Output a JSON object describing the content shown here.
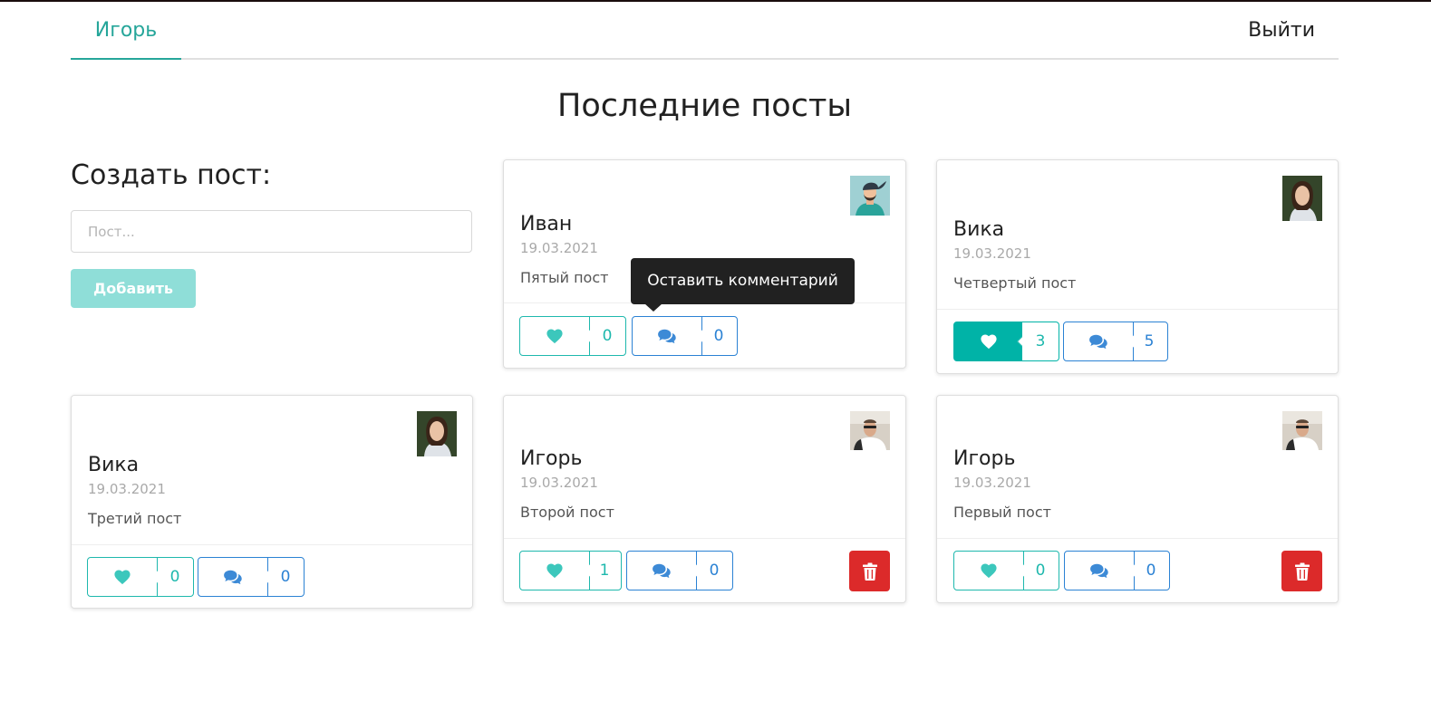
{
  "nav": {
    "user_name": "Игорь",
    "logout_label": "Выйти"
  },
  "page_title": "Последние посты",
  "create": {
    "title": "Создать пост:",
    "placeholder": "Пост...",
    "add_label": "Добавить"
  },
  "tooltip": "Оставить комментарий",
  "colors": {
    "accent": "#26a69a",
    "like": "#1eb8ad",
    "comment": "#2b82d4",
    "delete": "#dc2a2a",
    "add_button": "#8fded8"
  },
  "posts": [
    {
      "author": "Иван",
      "date": "19.03.2021",
      "text": "Пятый пост",
      "likes": "0",
      "comments": "0",
      "liked": false
    },
    {
      "author": "Вика",
      "date": "19.03.2021",
      "text": "Четвертый пост",
      "likes": "3",
      "comments": "5",
      "liked": true
    },
    {
      "author": "Вика",
      "date": "19.03.2021",
      "text": "Третий пост",
      "likes": "0",
      "comments": "0",
      "liked": false
    },
    {
      "author": "Игорь",
      "date": "19.03.2021",
      "text": "Второй пост",
      "likes": "1",
      "comments": "0",
      "liked": false,
      "deletable": true
    },
    {
      "author": "Игорь",
      "date": "19.03.2021",
      "text": "Первый пост",
      "likes": "0",
      "comments": "0",
      "liked": false,
      "deletable": true
    }
  ]
}
